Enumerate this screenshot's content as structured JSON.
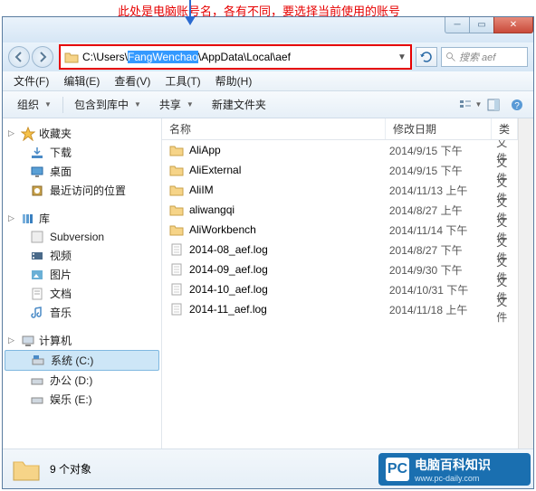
{
  "annotation": "此处是电脑账号名，各有不同，要选择当前使用的账号",
  "address": {
    "prefix": "C:\\Users\\",
    "highlighted": "FangWenchao",
    "suffix": "\\AppData\\Local\\aef"
  },
  "search": {
    "placeholder": "搜索 aef"
  },
  "menus": [
    "文件(F)",
    "编辑(E)",
    "查看(V)",
    "工具(T)",
    "帮助(H)"
  ],
  "toolbar": {
    "organize": "组织",
    "include": "包含到库中",
    "share": "共享",
    "newfolder": "新建文件夹"
  },
  "columns": {
    "name": "名称",
    "date": "修改日期",
    "type": "类"
  },
  "nav": {
    "favorites": {
      "label": "收藏夹",
      "items": [
        "下载",
        "桌面",
        "最近访问的位置"
      ]
    },
    "libraries": {
      "label": "库",
      "items": [
        "Subversion",
        "视频",
        "图片",
        "文档",
        "音乐"
      ]
    },
    "computer": {
      "label": "计算机",
      "items": [
        "系统 (C:)",
        "办公 (D:)",
        "娱乐 (E:)"
      ]
    }
  },
  "files": [
    {
      "icon": "folder",
      "name": "AliApp",
      "date": "2014/9/15 下午",
      "type": "文件"
    },
    {
      "icon": "folder",
      "name": "AliExternal",
      "date": "2014/9/15 下午",
      "type": "文件"
    },
    {
      "icon": "folder",
      "name": "AliIM",
      "date": "2014/11/13 上午",
      "type": "文件"
    },
    {
      "icon": "folder",
      "name": "aliwangqi",
      "date": "2014/8/27 上午",
      "type": "文件"
    },
    {
      "icon": "folder",
      "name": "AliWorkbench",
      "date": "2014/11/14 下午",
      "type": "文件"
    },
    {
      "icon": "file",
      "name": "2014-08_aef.log",
      "date": "2014/8/27 下午",
      "type": "文件"
    },
    {
      "icon": "file",
      "name": "2014-09_aef.log",
      "date": "2014/9/30 下午",
      "type": "文件"
    },
    {
      "icon": "file",
      "name": "2014-10_aef.log",
      "date": "2014/10/31 下午",
      "type": "文件"
    },
    {
      "icon": "file",
      "name": "2014-11_aef.log",
      "date": "2014/11/18 上午",
      "type": "文件"
    }
  ],
  "status": {
    "count": "9 个对象"
  },
  "watermark": {
    "title": "电脑百科知识",
    "sub": "www.pc-daily.com"
  }
}
